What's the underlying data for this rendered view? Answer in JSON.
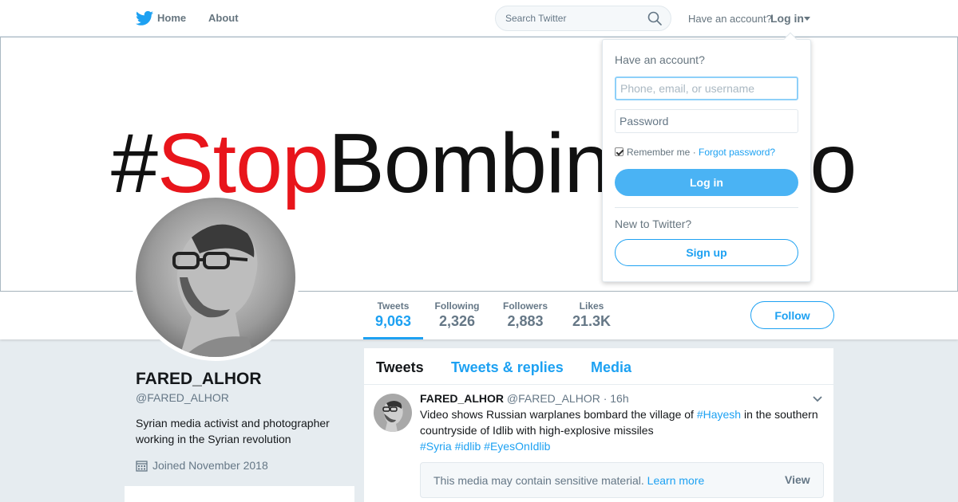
{
  "nav": {
    "logo_icon": "twitter-bird-icon",
    "home_label": "Home",
    "about_label": "About",
    "search_placeholder": "Search Twitter",
    "search_icon": "search-icon",
    "have_account": "Have an account?",
    "login_label": "Log in"
  },
  "banner": {
    "hash": "#",
    "red_text": "Stop",
    "black_text": "Bombin",
    "tail": "o"
  },
  "stats": [
    {
      "label": "Tweets",
      "value": "9,063"
    },
    {
      "label": "Following",
      "value": "2,326"
    },
    {
      "label": "Followers",
      "value": "2,883"
    },
    {
      "label": "Likes",
      "value": "21.3K"
    }
  ],
  "follow_label": "Follow",
  "profile": {
    "name": "FARED_ALHOR",
    "handle": "@FARED_ALHOR",
    "bio": "Syrian media activist and photographer working in the Syrian revolution",
    "joined": "Joined November 2018"
  },
  "timeline": {
    "tabs": [
      "Tweets",
      "Tweets & replies",
      "Media"
    ],
    "tweet": {
      "name": "FARED_ALHOR",
      "handle": "@FARED_ALHOR",
      "time": "· 16h",
      "text_before": "Video shows Russian warplanes bombard the village of ",
      "tag_inline": "#Hayesh",
      "text_after": " in the southern countryside of Idlib with high-explosive missiles",
      "hashtags": [
        "#Syria",
        "#idlib",
        "#EyesOnIdlib"
      ],
      "sensitive_text": "This media may contain sensitive material.",
      "sensitive_link": "Learn more",
      "view_label": "View"
    }
  },
  "login_dropdown": {
    "title": "Have an account?",
    "username_placeholder": "Phone, email, or username",
    "password_placeholder": "Password",
    "remember": "Remember me",
    "separator": "·",
    "forgot": "Forgot password?",
    "login_button": "Log in",
    "new_text": "New to Twitter?",
    "signup_button": "Sign up"
  },
  "colors": {
    "accent": "#1da1f2",
    "login_button": "#4ab3f4",
    "banner_red": "#e8151b",
    "background": "#e6ecf0"
  }
}
